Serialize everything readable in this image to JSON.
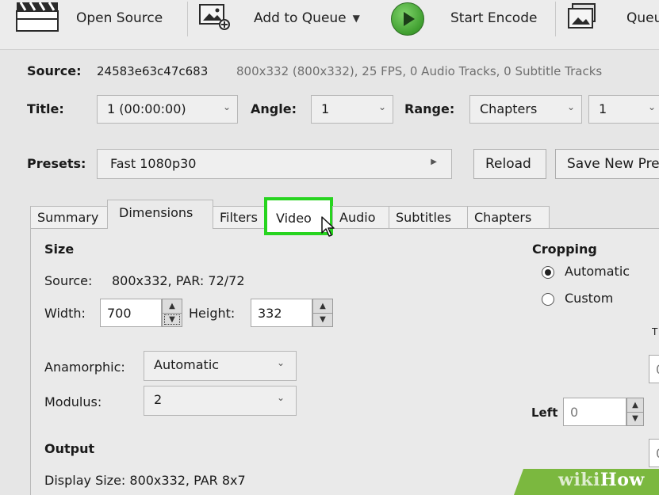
{
  "toolbar": {
    "open_source": "Open Source",
    "add_to_queue": "Add to Queue",
    "start_encode": "Start Encode",
    "queue": "Queu"
  },
  "source": {
    "label": "Source:",
    "name": "24583e63c47c683",
    "info": "800x332 (800x332), 25 FPS, 0 Audio Tracks, 0 Subtitle Tracks"
  },
  "title_row": {
    "title_label": "Title:",
    "title_value": "1 (00:00:00)",
    "angle_label": "Angle:",
    "angle_value": "1",
    "range_label": "Range:",
    "range_value": "Chapters",
    "range_start": "1"
  },
  "presets": {
    "label": "Presets:",
    "value": "Fast 1080p30",
    "reload": "Reload",
    "save_new": "Save New Pre"
  },
  "tabs": [
    {
      "label": "Summary"
    },
    {
      "label": "Dimensions"
    },
    {
      "label": "Filters"
    },
    {
      "label": "Video"
    },
    {
      "label": "Audio"
    },
    {
      "label": "Subtitles"
    },
    {
      "label": "Chapters"
    }
  ],
  "size": {
    "heading": "Size",
    "source_label": "Source:",
    "source_value": "800x332, PAR: 72/72",
    "width_label": "Width:",
    "width_value": "700",
    "height_label": "Height:",
    "height_value": "332",
    "anamorphic_label": "Anamorphic:",
    "anamorphic_value": "Automatic",
    "modulus_label": "Modulus:",
    "modulus_value": "2"
  },
  "output": {
    "heading": "Output",
    "display_size": "Display Size: 800x332,  PAR 8x7"
  },
  "cropping": {
    "heading": "Cropping",
    "automatic": "Automatic",
    "custom": "Custom",
    "left_label": "Left",
    "left_value": "0",
    "field_a": "0",
    "field_b": "0"
  },
  "watermark": {
    "wiki": "wiki",
    "how": "How"
  },
  "colors": {
    "highlight": "#27d41f",
    "watermark_bg": "#7bb83f"
  }
}
